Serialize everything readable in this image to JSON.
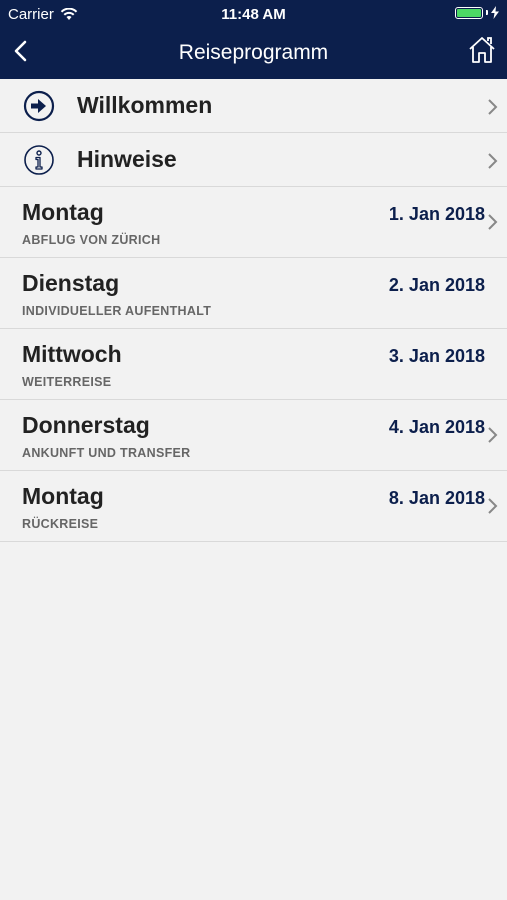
{
  "status": {
    "carrier": "Carrier",
    "time": "11:48 AM",
    "battery_level": 1.0
  },
  "nav": {
    "title": "Reiseprogramm"
  },
  "menu": [
    {
      "label": "Willkommen",
      "icon": "arrow-right-circle-icon"
    },
    {
      "label": "Hinweise",
      "icon": "info-circle-icon"
    }
  ],
  "days": [
    {
      "day": "Montag",
      "subtitle": "ABFLUG VON ZÜRICH",
      "date": "1. Jan 2018",
      "has_chevron": true
    },
    {
      "day": "Dienstag",
      "subtitle": "INDIVIDUELLER AUFENTHALT",
      "date": "2. Jan 2018",
      "has_chevron": false
    },
    {
      "day": "Mittwoch",
      "subtitle": "WEITERREISE",
      "date": "3. Jan 2018",
      "has_chevron": false
    },
    {
      "day": "Donnerstag",
      "subtitle": "ANKUNFT UND TRANSFER",
      "date": "4. Jan 2018",
      "has_chevron": true
    },
    {
      "day": "Montag",
      "subtitle": "RÜCKREISE",
      "date": "8. Jan 2018",
      "has_chevron": true
    }
  ],
  "colors": {
    "navbar": "#0c1f4c",
    "date": "#0c1f4c",
    "background": "#f2f2f2",
    "battery": "#4cd964"
  }
}
